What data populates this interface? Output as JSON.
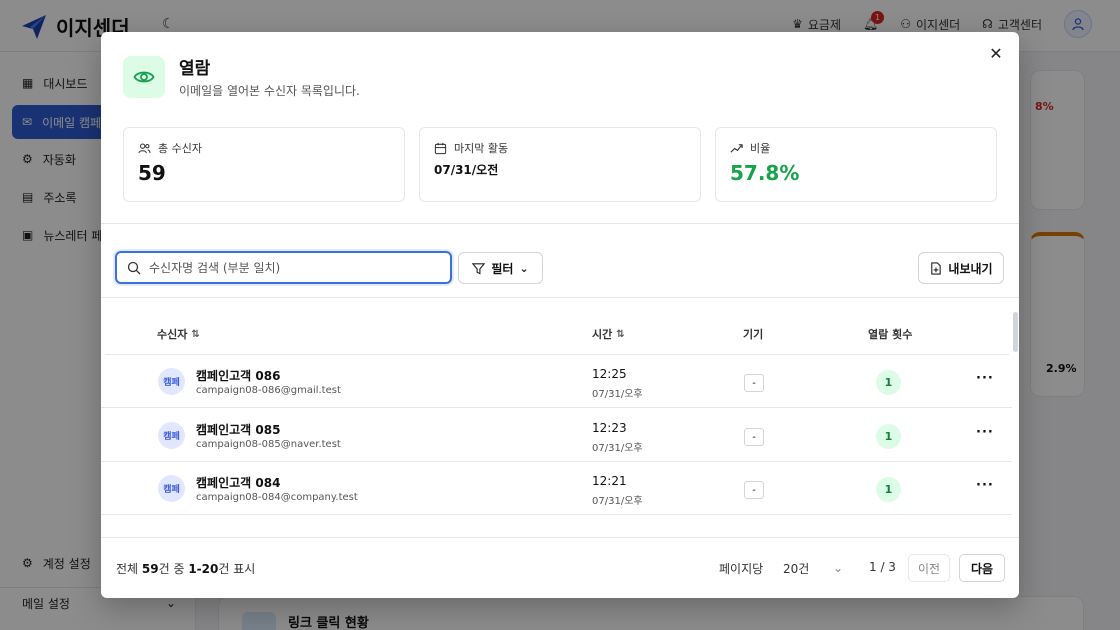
{
  "app": {
    "brand": "이지센더",
    "topnav": {
      "pricing": "요금제",
      "bell_badge": "1",
      "account": "이지센더",
      "support": "고객센터"
    },
    "sidebar": {
      "items": [
        {
          "label": "대시보드",
          "icon": "dashboard-icon"
        },
        {
          "label": "이메일 캠페",
          "icon": "mail-icon",
          "active": true
        },
        {
          "label": "자동화",
          "icon": "automation-icon"
        },
        {
          "label": "주소록",
          "icon": "book-icon"
        },
        {
          "label": "뉴스레터 페",
          "icon": "newsletter-icon"
        }
      ],
      "settings": "계정 설정",
      "mail_settings": "메일 설정"
    },
    "background": {
      "pct_red": "8%",
      "pct_small": "2.9%",
      "section_title": "링크 클릭 현황"
    }
  },
  "modal": {
    "title": "열람",
    "subtitle": "이메일을 열어본 수신자 목록입니다.",
    "stats": [
      {
        "label": "총 수신자",
        "value": "59",
        "icon": "users-icon"
      },
      {
        "label": "마지막 활동",
        "value": "07/31/오전",
        "icon": "calendar-icon"
      },
      {
        "label": "비율",
        "value": "57.8%",
        "icon": "trend-up-icon"
      }
    ],
    "search": {
      "placeholder": "수신자명 검색 (부분 일치)",
      "value": ""
    },
    "filter_label": "필터",
    "export_label": "내보내기",
    "columns": {
      "recipient": "수신자",
      "time": "시간",
      "device": "기기",
      "opens": "열람 횟수"
    },
    "rows": [
      {
        "avatar": "캠페",
        "name": "캠페인고객 086",
        "email": "campaign08-086@gmail.test",
        "time": "12:25",
        "date": "07/31/오후",
        "device": "-",
        "opens": "1"
      },
      {
        "avatar": "캠페",
        "name": "캠페인고객 085",
        "email": "campaign08-085@naver.test",
        "time": "12:23",
        "date": "07/31/오후",
        "device": "-",
        "opens": "1"
      },
      {
        "avatar": "캠페",
        "name": "캠페인고객 084",
        "email": "campaign08-084@company.test",
        "time": "12:21",
        "date": "07/31/오후",
        "device": "-",
        "opens": "1"
      }
    ],
    "footer": {
      "prefix": "전체 ",
      "total": "59",
      "mid": "건 중 ",
      "range": "1-20",
      "suffix": "건 표시",
      "per_page_label": "페이지당",
      "per_page_value": "20건",
      "page_indicator": "1 / 3",
      "prev_label": "이전",
      "next_label": "다음"
    }
  }
}
